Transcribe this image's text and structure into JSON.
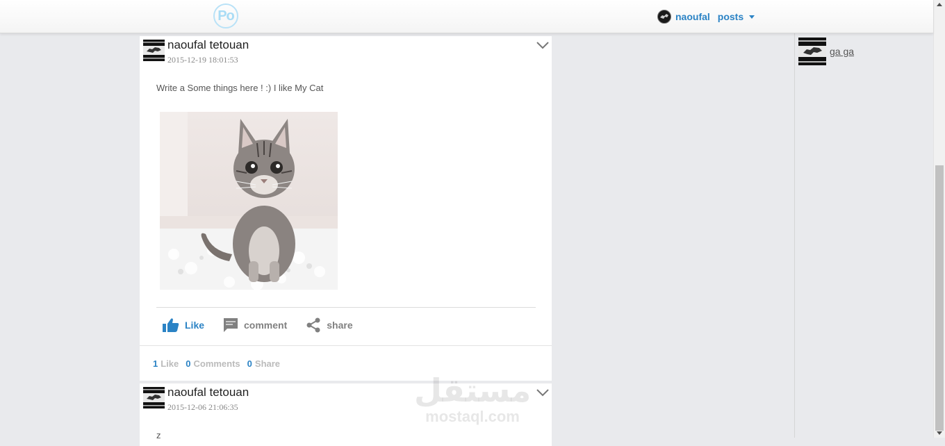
{
  "header": {
    "logo_text": "Po",
    "username": "naoufal",
    "menu_label": "posts"
  },
  "sidebar": {
    "contacts": [
      {
        "name": "ga ga"
      }
    ]
  },
  "posts": [
    {
      "author": "naoufal tetouan",
      "date": "2015-12-19 18:01:53",
      "text": "Write a Some things here ! :) I like My Cat",
      "actions": {
        "like": "Like",
        "comment": "comment",
        "share": "share"
      },
      "stats": {
        "likes_count": "1",
        "likes_label": "Like",
        "comments_count": "0",
        "comments_label": "Comments",
        "shares_count": "0",
        "shares_label": "Share"
      }
    },
    {
      "author": "naoufal tetouan",
      "date": "2015-12-06 21:06:35",
      "text": "z"
    }
  ],
  "watermark": {
    "arabic": "مستقل",
    "latin": "mostaql.com"
  },
  "colors": {
    "accent": "#2b83c5",
    "background": "#e9eaed",
    "logo": "#a9dcf5"
  }
}
